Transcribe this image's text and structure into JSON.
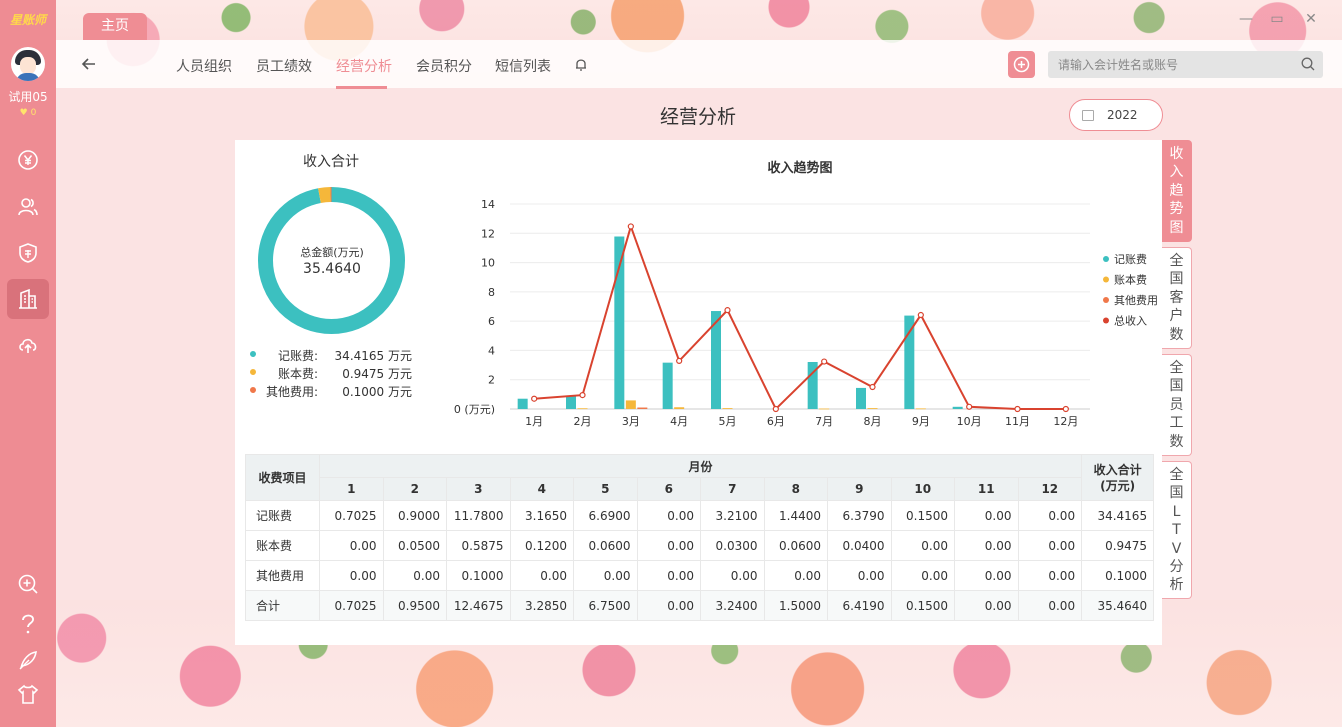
{
  "brand": "星账师",
  "user": {
    "name": "试用05",
    "points": "0"
  },
  "home_tab": "主页",
  "window": {
    "minimize": "—",
    "maximize": "▭",
    "close": "✕"
  },
  "nav": {
    "items": [
      "人员组织",
      "员工绩效",
      "经营分析",
      "会员积分",
      "短信列表"
    ],
    "active": "经营分析"
  },
  "search": {
    "placeholder": "请输入会计姓名或账号"
  },
  "page": {
    "title": "经营分析",
    "year": "2022"
  },
  "side_tabs": [
    "收入趋势图",
    "全国客户数",
    "全国员工数",
    "全国LTV分析"
  ],
  "donut": {
    "title": "收入合计",
    "center_label": "总金额(万元)",
    "total": "35.4640",
    "segments": [
      {
        "label": "记账费:",
        "value": "34.4165 万元",
        "amount": 34.4165,
        "color": "#3cc0c0"
      },
      {
        "label": "账本费:",
        "value": "0.9475 万元",
        "amount": 0.9475,
        "color": "#f5b73a"
      },
      {
        "label": "其他费用:",
        "value": "0.1000 万元",
        "amount": 0.1,
        "color": "#f0784a"
      }
    ]
  },
  "colors": {
    "accent": "#ef8d94",
    "sidebar": "#ee8c93",
    "teal": "#3cc0c0",
    "yellow": "#f5b73a",
    "orange": "#f0784a",
    "red": "#d9432f"
  },
  "chart_data": {
    "type": "bar",
    "title": "收入趋势图",
    "categories": [
      "1月",
      "2月",
      "3月",
      "4月",
      "5月",
      "6月",
      "7月",
      "8月",
      "9月",
      "10月",
      "11月",
      "12月"
    ],
    "ylim": [
      0,
      14
    ],
    "yticks": [
      "0 (万元)",
      "2",
      "4",
      "6",
      "8",
      "10",
      "12",
      "14"
    ],
    "legend_position": "right",
    "series": [
      {
        "name": "记账费",
        "type": "bar",
        "color": "#3cc0c0",
        "values": [
          0.7025,
          0.9,
          11.78,
          3.165,
          6.69,
          0,
          3.21,
          1.44,
          6.379,
          0.15,
          0,
          0
        ]
      },
      {
        "name": "账本费",
        "type": "bar",
        "color": "#f5b73a",
        "values": [
          0,
          0.05,
          0.5875,
          0.12,
          0.06,
          0,
          0.03,
          0.06,
          0.04,
          0,
          0,
          0
        ]
      },
      {
        "name": "其他费用",
        "type": "bar",
        "color": "#f0784a",
        "values": [
          0,
          0,
          0.1,
          0,
          0,
          0,
          0,
          0,
          0,
          0,
          0,
          0
        ]
      },
      {
        "name": "总收入",
        "type": "line",
        "color": "#d9432f",
        "values": [
          0.7025,
          0.95,
          12.4675,
          3.285,
          6.75,
          0,
          3.24,
          1.5,
          6.419,
          0.15,
          0,
          0
        ]
      }
    ]
  },
  "table": {
    "item_header": "收费项目",
    "month_header": "月份",
    "total_header": "收入合计\n(万元)",
    "months": [
      "1",
      "2",
      "3",
      "4",
      "5",
      "6",
      "7",
      "8",
      "9",
      "10",
      "11",
      "12"
    ],
    "rows": [
      {
        "name": "记账费",
        "cells": [
          "0.7025",
          "0.9000",
          "11.7800",
          "3.1650",
          "6.6900",
          "0.00",
          "3.2100",
          "1.4400",
          "6.3790",
          "0.1500",
          "0.00",
          "0.00"
        ],
        "total": "34.4165"
      },
      {
        "name": "账本费",
        "cells": [
          "0.00",
          "0.0500",
          "0.5875",
          "0.1200",
          "0.0600",
          "0.00",
          "0.0300",
          "0.0600",
          "0.0400",
          "0.00",
          "0.00",
          "0.00"
        ],
        "total": "0.9475"
      },
      {
        "name": "其他费用",
        "cells": [
          "0.00",
          "0.00",
          "0.1000",
          "0.00",
          "0.00",
          "0.00",
          "0.00",
          "0.00",
          "0.00",
          "0.00",
          "0.00",
          "0.00"
        ],
        "total": "0.1000"
      },
      {
        "name": "合计",
        "cells": [
          "0.7025",
          "0.9500",
          "12.4675",
          "3.2850",
          "6.7500",
          "0.00",
          "3.2400",
          "1.5000",
          "6.4190",
          "0.1500",
          "0.00",
          "0.00"
        ],
        "total": "35.4640"
      }
    ]
  }
}
